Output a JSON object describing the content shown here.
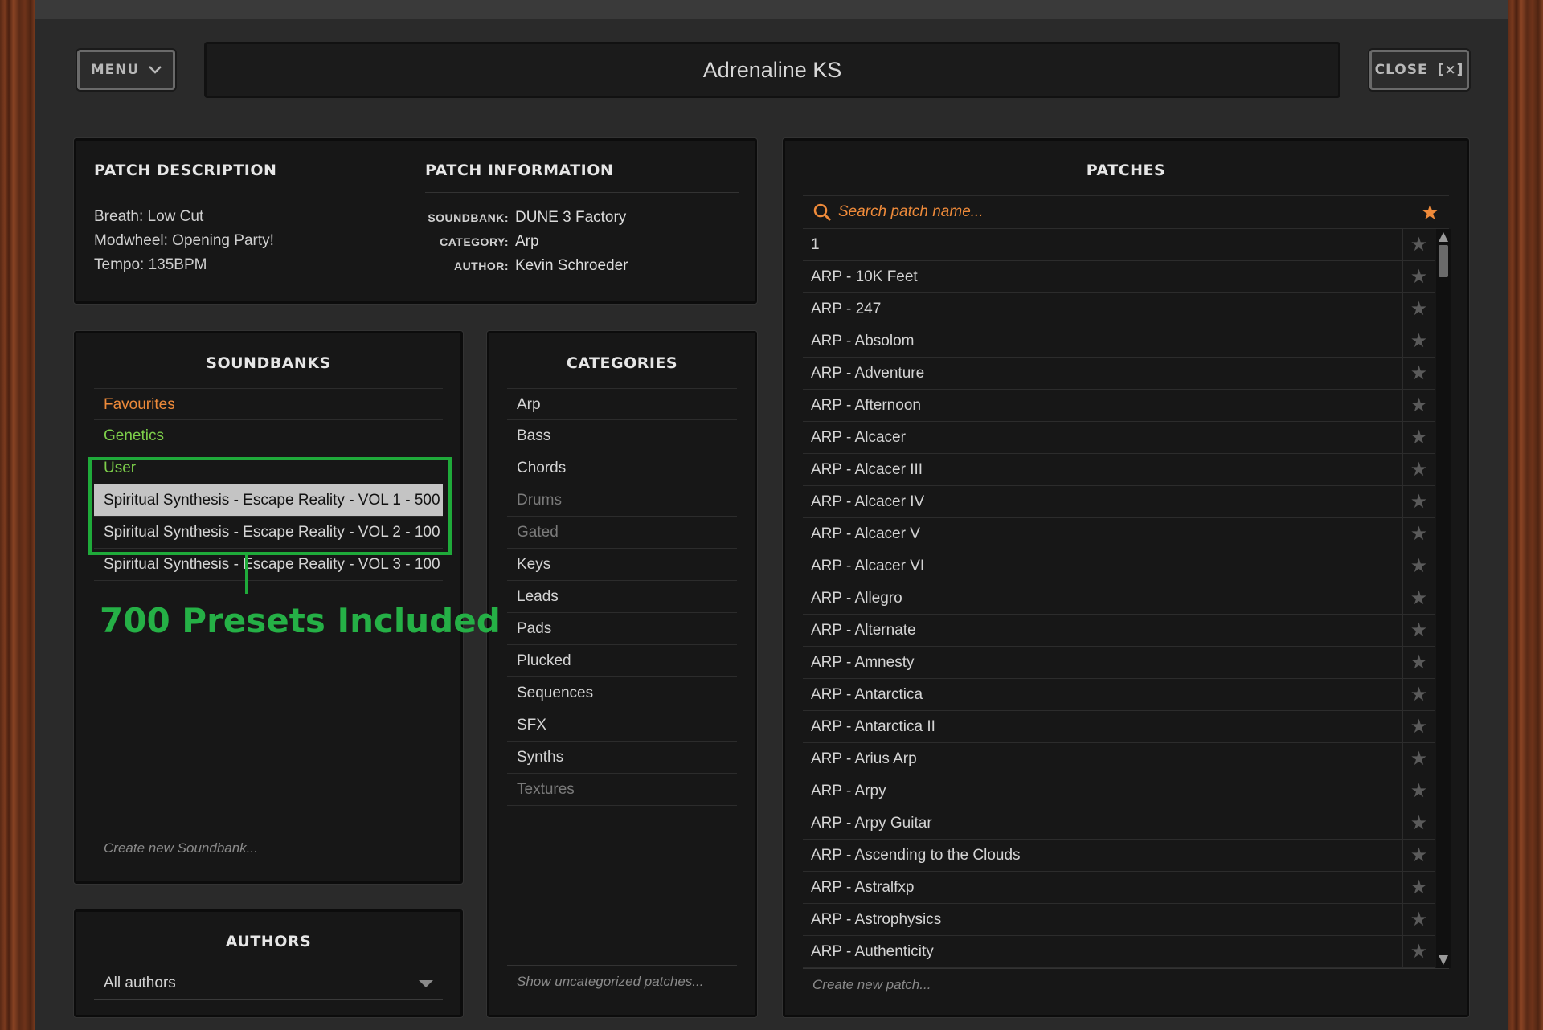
{
  "header": {
    "menu_label": "MENU",
    "title": "Adrenaline KS",
    "close_label": "CLOSE",
    "close_glyph": "[×]"
  },
  "patch_description": {
    "title": "PATCH DESCRIPTION",
    "lines": [
      "Breath: Low Cut",
      "Modwheel: Opening Party!",
      "Tempo: 135BPM"
    ]
  },
  "patch_information": {
    "title": "PATCH INFORMATION",
    "rows": [
      {
        "key": "SOUNDBANK:",
        "value": "DUNE 3 Factory"
      },
      {
        "key": "CATEGORY:",
        "value": "Arp"
      },
      {
        "key": "AUTHOR:",
        "value": "Kevin Schroeder"
      }
    ]
  },
  "soundbanks": {
    "title": "SOUNDBANKS",
    "items": [
      {
        "label": "Favourites",
        "style": "orange"
      },
      {
        "label": "Genetics",
        "style": "green"
      },
      {
        "label": "User",
        "style": "green"
      },
      {
        "label": "Spiritual Synthesis - Escape Reality - VOL 1 - 500",
        "style": "selected"
      },
      {
        "label": "Spiritual Synthesis - Escape Reality - VOL 2 - 100",
        "style": "normal"
      },
      {
        "label": "Spiritual Synthesis - Escape Reality - VOL 3 - 100",
        "style": "normal"
      }
    ],
    "footer": "Create new Soundbank..."
  },
  "callout": {
    "text": "700 Presets Included",
    "color": "#25b046"
  },
  "authors": {
    "title": "AUTHORS",
    "selected": "All authors"
  },
  "categories": {
    "title": "CATEGORIES",
    "items": [
      {
        "label": "Arp",
        "dim": false
      },
      {
        "label": "Bass",
        "dim": false
      },
      {
        "label": "Chords",
        "dim": false
      },
      {
        "label": "Drums",
        "dim": true
      },
      {
        "label": "Gated",
        "dim": true
      },
      {
        "label": "Keys",
        "dim": false
      },
      {
        "label": "Leads",
        "dim": false
      },
      {
        "label": "Pads",
        "dim": false
      },
      {
        "label": "Plucked",
        "dim": false
      },
      {
        "label": "Sequences",
        "dim": false
      },
      {
        "label": "SFX",
        "dim": false
      },
      {
        "label": "Synths",
        "dim": false
      },
      {
        "label": "Textures",
        "dim": true
      }
    ],
    "footer": "Show uncategorized patches..."
  },
  "patches": {
    "title": "PATCHES",
    "search_placeholder": "Search patch name...",
    "items": [
      "1",
      "ARP - 10K Feet",
      "ARP - 247",
      "ARP - Absolom",
      "ARP - Adventure",
      "ARP - Afternoon",
      "ARP - Alcacer",
      "ARP - Alcacer III",
      "ARP - Alcacer IV",
      "ARP - Alcacer V",
      "ARP - Alcacer VI",
      "ARP - Allegro",
      "ARP - Alternate",
      "ARP - Amnesty",
      "ARP - Antarctica",
      "ARP - Antarctica II",
      "ARP - Arius Arp",
      "ARP - Arpy",
      "ARP - Arpy Guitar",
      "ARP - Ascending to the Clouds",
      "ARP - Astralfxp",
      "ARP - Astrophysics",
      "ARP - Authenticity"
    ],
    "footer": "Create new patch..."
  },
  "colors": {
    "accent_orange": "#ee8a3a",
    "accent_green": "#7dcf4a",
    "highlight_green": "#1faa3a"
  }
}
